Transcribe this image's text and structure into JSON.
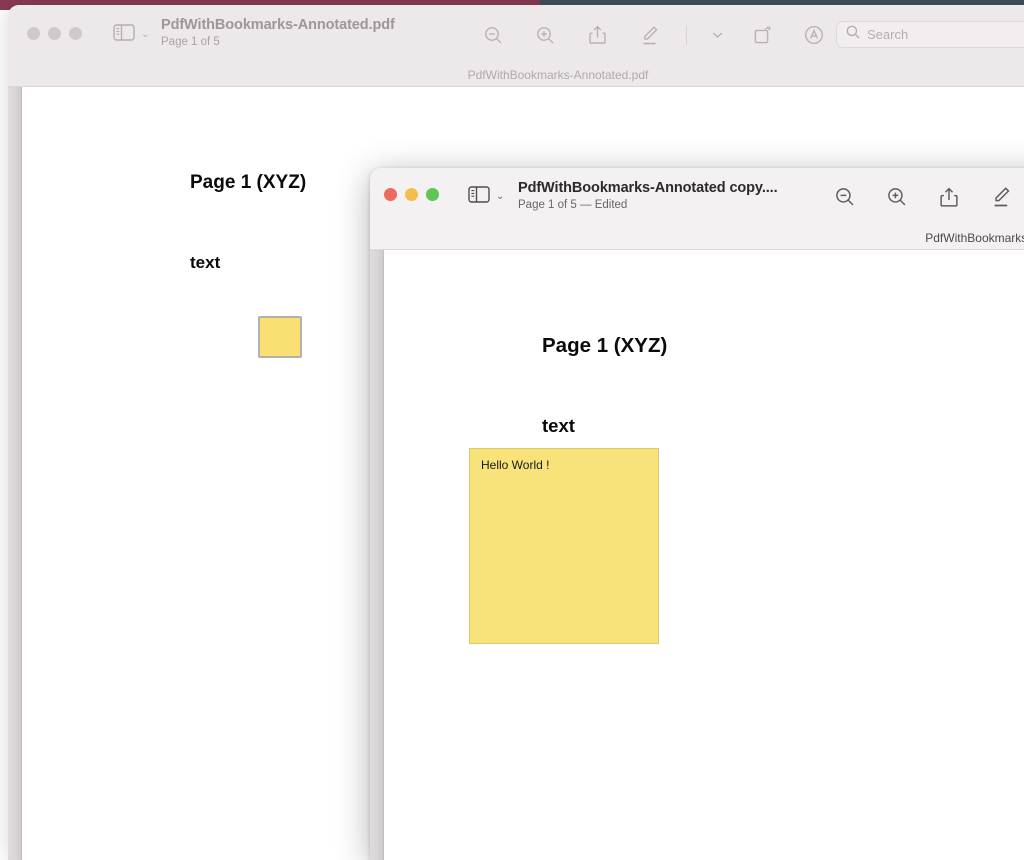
{
  "desktop": {
    "strip_left_color": "#8b3a54",
    "strip_right_color": "#41505f"
  },
  "background_window": {
    "active": false,
    "traffic_lights": [
      {
        "name": "close",
        "color": "#cfc9cb"
      },
      {
        "name": "minimize",
        "color": "#cfc9cb"
      },
      {
        "name": "zoom",
        "color": "#cfc9cb"
      }
    ],
    "sidebar_toggle_label": "sidebar-toggle",
    "chevron": "⌄",
    "title": "PdfWithBookmarks-Annotated.pdf",
    "subtitle": "Page 1 of 5",
    "proxy_filename": "PdfWithBookmarks-Annotated.pdf",
    "toolbar": [
      {
        "name": "zoom-out-icon",
        "label": "Zoom Out"
      },
      {
        "name": "zoom-in-icon",
        "label": "Zoom In"
      },
      {
        "name": "share-icon",
        "label": "Share"
      },
      {
        "name": "highlight-pen-icon",
        "label": "Highlight"
      },
      {
        "name": "chevron-down-icon",
        "label": "Highlight Options"
      },
      {
        "name": "rotate-icon",
        "label": "Rotate"
      },
      {
        "name": "markup-icon",
        "label": "Markup"
      }
    ],
    "search": {
      "placeholder": "Search",
      "icon": "search-icon"
    },
    "document": {
      "heading": "Page 1 (XYZ)",
      "body": "text",
      "annotation": {
        "type": "collapsed-note",
        "color": "#f9e073",
        "border_color": "#b4b0ab"
      }
    }
  },
  "front_window": {
    "active": true,
    "traffic_lights": [
      {
        "name": "close",
        "color": "#ed6a5e"
      },
      {
        "name": "minimize",
        "color": "#f4bd4f"
      },
      {
        "name": "zoom",
        "color": "#61c454"
      }
    ],
    "sidebar_toggle_label": "sidebar-toggle",
    "chevron": "⌄",
    "title": "PdfWithBookmarks-Annotated copy....",
    "subtitle": "Page 1 of 5 — Edited",
    "proxy_filename": "PdfWithBookmarks-Annotated",
    "toolbar": [
      {
        "name": "zoom-out-icon",
        "label": "Zoom Out"
      },
      {
        "name": "zoom-in-icon",
        "label": "Zoom In"
      },
      {
        "name": "share-icon",
        "label": "Share"
      },
      {
        "name": "highlight-pen-icon",
        "label": "Highlight"
      }
    ],
    "document": {
      "heading": "Page 1 (XYZ)",
      "body": "text",
      "annotation": {
        "type": "open-note",
        "text": "Hello World !",
        "color": "#f8e37a",
        "border_color": "#dcc96b"
      }
    }
  }
}
